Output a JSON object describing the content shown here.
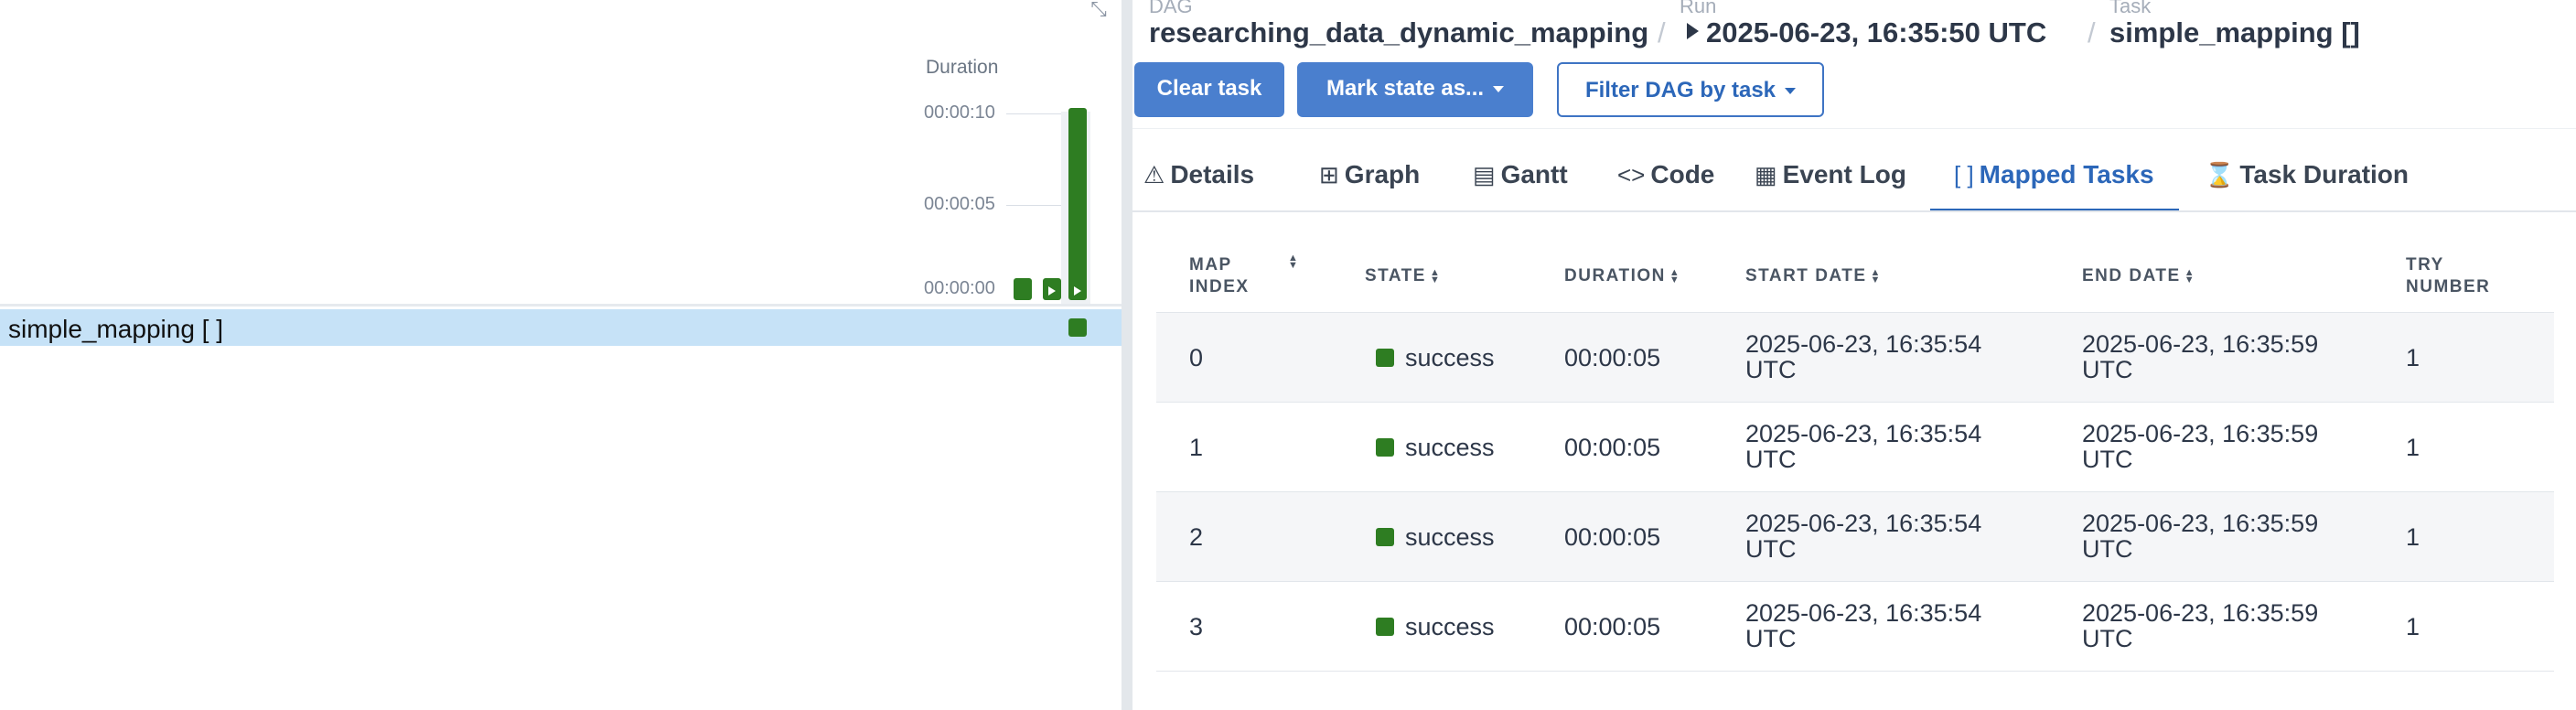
{
  "left_panel": {
    "duration_label": "Duration",
    "y_ticks": [
      "00:00:10",
      "00:00:05",
      "00:00:00"
    ],
    "bars": [
      {
        "duration_seconds": 0.9,
        "has_play_icon": false
      },
      {
        "duration_seconds": 0.9,
        "has_play_icon": true
      },
      {
        "duration_seconds": 10.1,
        "has_play_icon": true
      }
    ],
    "task_row_label": "simple_mapping [ ]",
    "success_color": "#2e7d22"
  },
  "breadcrumb": {
    "dag_caption": "DAG",
    "dag_value": "researching_data_dynamic_mapping",
    "run_caption": "Run",
    "run_value": "2025-06-23, 16:35:50 UTC",
    "task_caption": "Task",
    "task_value": "simple_mapping []",
    "separator": "/"
  },
  "actions": {
    "clear_task": "Clear task",
    "mark_state": "Mark state as...",
    "filter_dag": "Filter DAG by task"
  },
  "tabs": [
    {
      "label": "Details",
      "icon": "warning-icon",
      "glyph": "⚠"
    },
    {
      "label": "Graph",
      "icon": "graph-icon",
      "glyph": "⊞"
    },
    {
      "label": "Gantt",
      "icon": "gantt-icon",
      "glyph": "▤"
    },
    {
      "label": "Code",
      "icon": "code-icon",
      "glyph": "<>"
    },
    {
      "label": "Event Log",
      "icon": "calendar-icon",
      "glyph": "▦"
    },
    {
      "label": "Mapped Tasks",
      "icon": "brackets-icon",
      "glyph": "[ ]"
    },
    {
      "label": "Task Duration",
      "icon": "hourglass-icon",
      "glyph": "⌛"
    }
  ],
  "active_tab": "Mapped Tasks",
  "accent_color": "#2c67b9",
  "table": {
    "headers": {
      "map_index": [
        "MAP",
        "INDEX"
      ],
      "state": "STATE",
      "duration": "DURATION",
      "start_date": "START DATE",
      "end_date": "END DATE",
      "try_number": [
        "TRY",
        "NUMBER"
      ]
    },
    "rows": [
      {
        "map_index": "0",
        "state": "success",
        "duration": "00:00:05",
        "start_date": [
          "2025-06-23, 16:35:54",
          "UTC"
        ],
        "end_date": [
          "2025-06-23, 16:35:59",
          "UTC"
        ],
        "try_number": "1"
      },
      {
        "map_index": "1",
        "state": "success",
        "duration": "00:00:05",
        "start_date": [
          "2025-06-23, 16:35:54",
          "UTC"
        ],
        "end_date": [
          "2025-06-23, 16:35:59",
          "UTC"
        ],
        "try_number": "1"
      },
      {
        "map_index": "2",
        "state": "success",
        "duration": "00:00:05",
        "start_date": [
          "2025-06-23, 16:35:54",
          "UTC"
        ],
        "end_date": [
          "2025-06-23, 16:35:59",
          "UTC"
        ],
        "try_number": "1"
      },
      {
        "map_index": "3",
        "state": "success",
        "duration": "00:00:05",
        "start_date": [
          "2025-06-23, 16:35:54",
          "UTC"
        ],
        "end_date": [
          "2025-06-23, 16:35:59",
          "UTC"
        ],
        "try_number": "1"
      }
    ]
  }
}
